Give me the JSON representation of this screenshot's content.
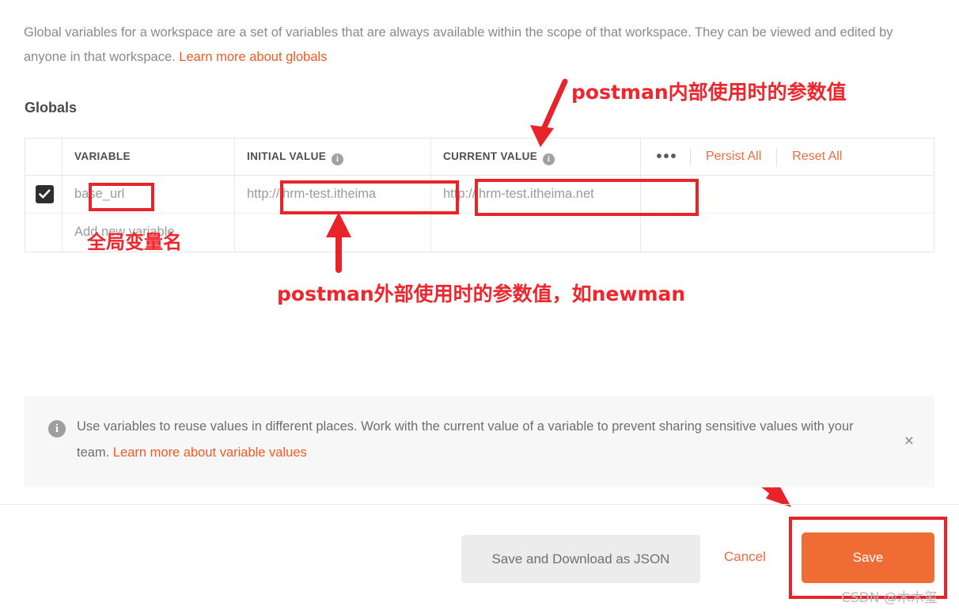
{
  "intro": {
    "line1": "Global variables for a workspace are a set of variables that are always available within the scope of that workspace. They",
    "line2": "can be viewed and edited by anyone in that workspace. ",
    "link": "Learn more about globals"
  },
  "section": {
    "title": "Globals"
  },
  "table": {
    "headers": {
      "variable": "VARIABLE",
      "initial_value": "INITIAL VALUE",
      "current_value": "CURRENT VALUE",
      "info_glyph": "i",
      "dots": "•••",
      "persist_all": "Persist All",
      "reset_all": "Reset All"
    },
    "rows": [
      {
        "checked": true,
        "check_glyph": "check-icon",
        "variable": "base_url",
        "initial_value": "http://ihrm-test.itheima",
        "current_value": "http://ihrm-test.itheima.net",
        "actions": ""
      },
      {
        "checked": false,
        "variable": "Add new variable",
        "initial_value": "",
        "current_value": "",
        "actions": ""
      }
    ]
  },
  "annotations": {
    "top": "postman内部使用时的参数值",
    "bottom": "postman外部使用时的参数值，如newman",
    "variable_name": "全局变量名"
  },
  "banner": {
    "icon_glyph": "i",
    "text": "Use variables to reuse values in different places. Work with the current value of a variable to prevent sharing sensitive values with your team. ",
    "link": "Learn more about variable values",
    "close": "×"
  },
  "footer": {
    "save_download_json": "Save and Download as JSON",
    "cancel": "Cancel",
    "save": "Save"
  },
  "watermark": "CSDN @木木玺",
  "colors": {
    "accent_orange": "#ef6c35",
    "link_orange": "#ef5b25",
    "annotation_red": "#f0262d",
    "box_red": "#e8232a",
    "banner_bg": "#f7f7f7",
    "muted_text": "#9b9b9b",
    "checkbox_dark": "#2e2e2e"
  }
}
